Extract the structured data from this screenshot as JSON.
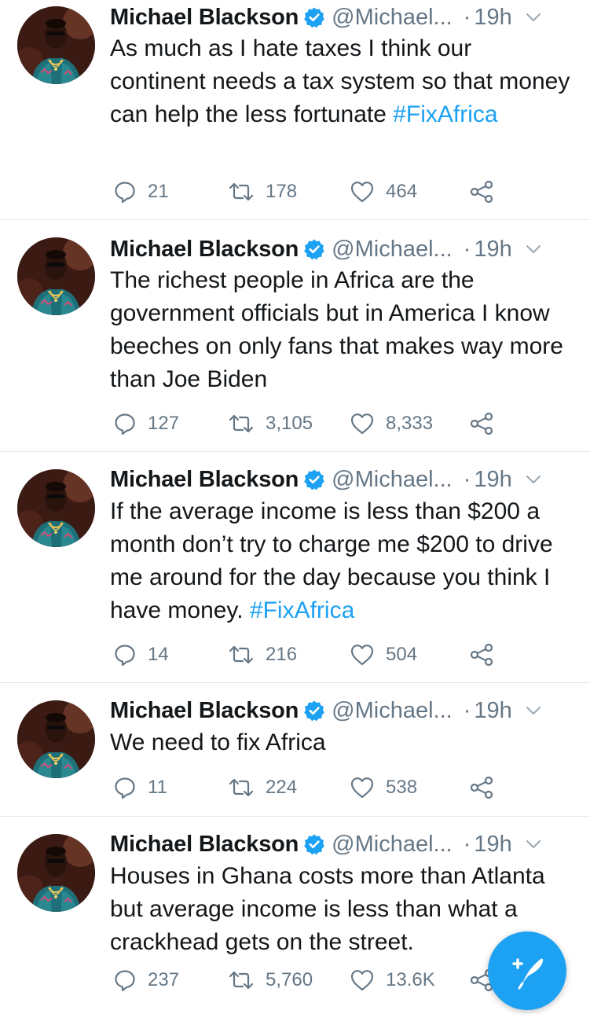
{
  "tweets": [
    {
      "name": "Michael Blackson",
      "handle": "@Michael...",
      "dot": "·",
      "time": "19h",
      "text": "As much as I hate taxes I think our continent needs a tax system so that money can help the less fortunate ",
      "hashtag": "#FixAfrica",
      "replies": "21",
      "retweets": "178",
      "likes": "464"
    },
    {
      "name": "Michael Blackson",
      "handle": "@Michael...",
      "dot": "·",
      "time": "19h",
      "text": "The richest people in Africa are the government officials but in America I know beeches on only fans that makes way more than Joe Biden",
      "hashtag": "",
      "replies": "127",
      "retweets": "3,105",
      "likes": "8,333"
    },
    {
      "name": "Michael Blackson",
      "handle": "@Michael...",
      "dot": "·",
      "time": "19h",
      "text": "If the average income is less than $200 a month don’t try to charge me $200 to drive me around for the day because you think I have money. ",
      "hashtag": "#FixAfrica",
      "replies": "14",
      "retweets": "216",
      "likes": "504"
    },
    {
      "name": "Michael Blackson",
      "handle": "@Michael...",
      "dot": "·",
      "time": "19h",
      "text": "We need to fix Africa",
      "hashtag": "",
      "replies": "11",
      "retweets": "224",
      "likes": "538"
    },
    {
      "name": "Michael Blackson",
      "handle": "@Michael...",
      "dot": "·",
      "time": "19h",
      "text": "Houses in Ghana costs more than Atlanta but average income is less than what a crackhead gets on the street.",
      "hashtag": "",
      "replies": "237",
      "retweets": "5,760",
      "likes": "13.6K"
    }
  ],
  "icons": {
    "verified": "verified-badge-icon",
    "caret": "chevron-down-icon",
    "reply": "reply-icon",
    "retweet": "retweet-icon",
    "like": "heart-icon",
    "share": "share-icon",
    "compose": "compose-tweet-icon"
  },
  "colors": {
    "accent": "#1da1f2",
    "text": "#14171a",
    "muted": "#657786",
    "divider": "#e1e8ed"
  }
}
